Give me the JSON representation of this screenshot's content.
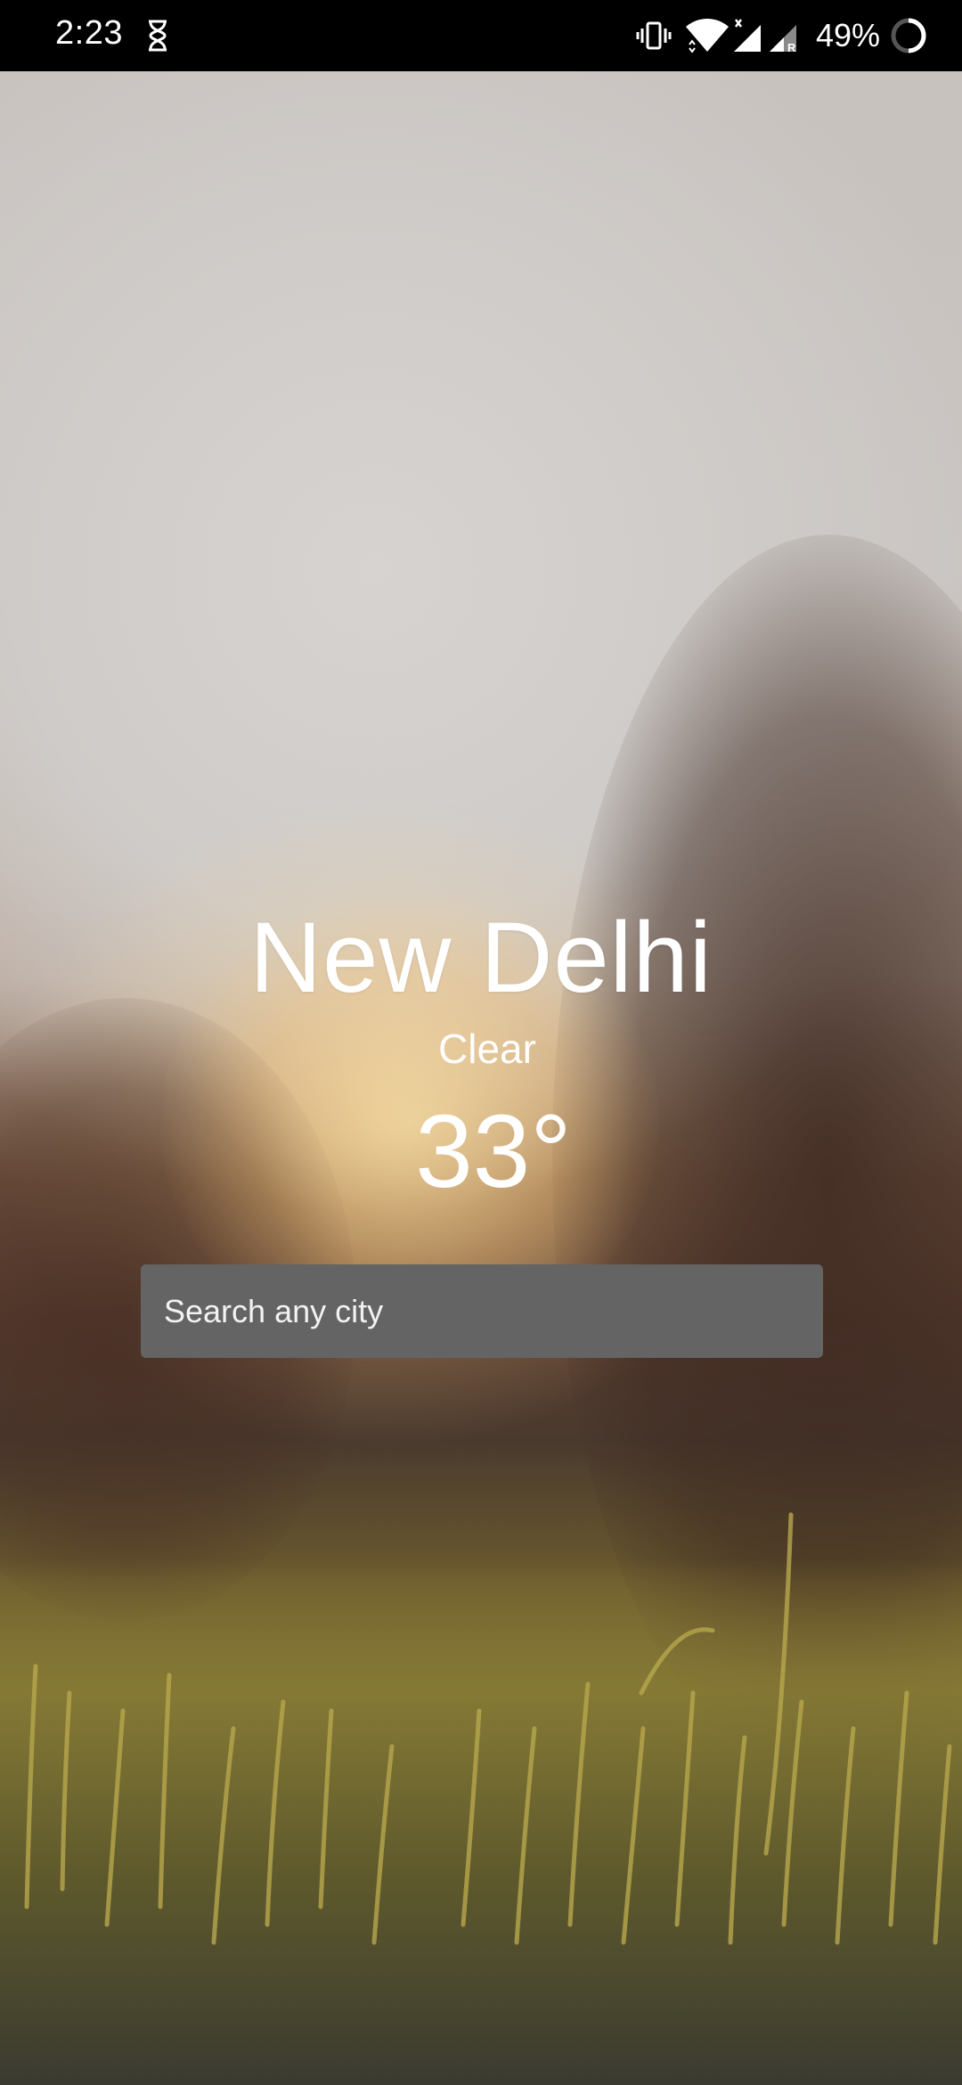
{
  "status_bar": {
    "time": "2:23",
    "battery_percent": "49%",
    "icons": [
      "hourglass-icon",
      "vibrate-icon",
      "wifi-icon",
      "signal-icon",
      "battery-icon"
    ]
  },
  "weather": {
    "city": "New Delhi",
    "condition": "Clear",
    "temperature": "33°"
  },
  "search": {
    "placeholder": "Search any city"
  },
  "colors": {
    "search_box": "#646464",
    "text": "#ffffff",
    "status_bar": "#000000"
  }
}
